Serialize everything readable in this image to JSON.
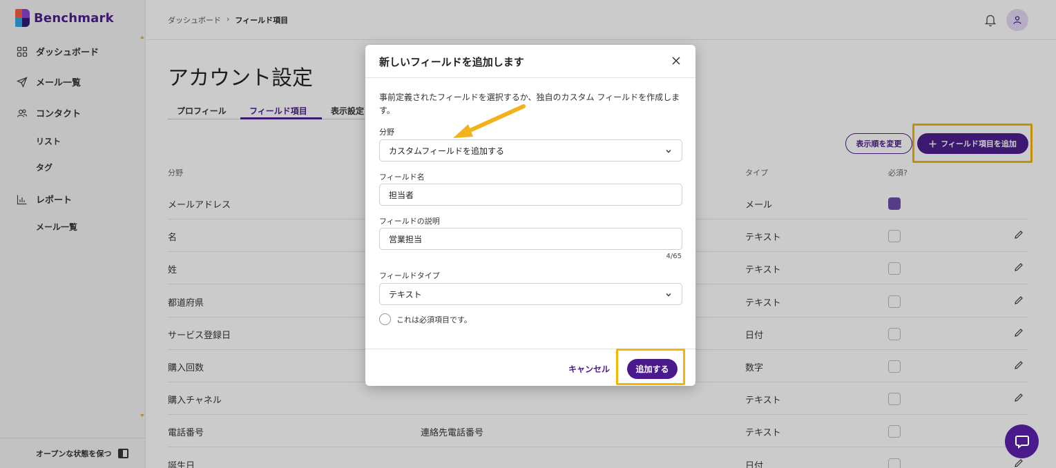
{
  "app": {
    "name": "Benchmark"
  },
  "sidebar": {
    "items": [
      {
        "label": "ダッシュボード",
        "icon": "grid-icon"
      },
      {
        "label": "メール一覧",
        "icon": "send-icon"
      },
      {
        "label": "コンタクト",
        "icon": "contacts-icon"
      },
      {
        "label": "リスト"
      },
      {
        "label": "タグ"
      },
      {
        "label": "レポート",
        "icon": "bar-chart-icon"
      },
      {
        "label": "メール一覧"
      }
    ],
    "footer_label": "オープンな状態を保つ"
  },
  "breadcrumb": {
    "parent": "ダッシュボード",
    "separator": "›",
    "current": "フィールド項目"
  },
  "page": {
    "title": "アカウント設定",
    "tabs": [
      "プロフィール",
      "フィールド項目",
      "表示設定"
    ],
    "reorder_label": "表示順を変更",
    "add_field_label": "フィールド項目を追加"
  },
  "table": {
    "headers": {
      "field": "分野",
      "type": "タイプ",
      "required": "必須?"
    },
    "rows": [
      {
        "name": "メールアドレス",
        "desc": "",
        "type": "メール",
        "required": true
      },
      {
        "name": "名",
        "desc": "",
        "type": "テキスト",
        "required": false
      },
      {
        "name": "姓",
        "desc": "",
        "type": "テキスト",
        "required": false
      },
      {
        "name": "都道府県",
        "desc": "",
        "type": "テキスト",
        "required": false
      },
      {
        "name": "サービス登録日",
        "desc": "",
        "type": "日付",
        "required": false
      },
      {
        "name": "購入回数",
        "desc": "",
        "type": "数字",
        "required": false
      },
      {
        "name": "購入チャネル",
        "desc": "",
        "type": "テキスト",
        "required": false
      },
      {
        "name": "電話番号",
        "desc": "連絡先電話番号",
        "type": "テキスト",
        "required": false
      },
      {
        "name": "誕生日",
        "desc": "",
        "type": "日付",
        "required": false
      }
    ]
  },
  "modal": {
    "title": "新しいフィールドを追加します",
    "intro": "事前定義されたフィールドを選択するか、独自のカスタム フィールドを作成します。",
    "category_label": "分野",
    "category_value": "カスタムフィールドを追加する",
    "name_label": "フィールド名",
    "name_value": "担当者",
    "desc_label": "フィールドの説明",
    "desc_value": "営業担当",
    "desc_counter": "4/65",
    "type_label": "フィールドタイプ",
    "type_value": "テキスト",
    "required_label": "これは必須項目です。",
    "cancel_label": "キャンセル",
    "submit_label": "追加する"
  },
  "colors": {
    "brand": "#4a1a8c",
    "highlight": "#f5b400",
    "arrow": "#f2b21b"
  }
}
